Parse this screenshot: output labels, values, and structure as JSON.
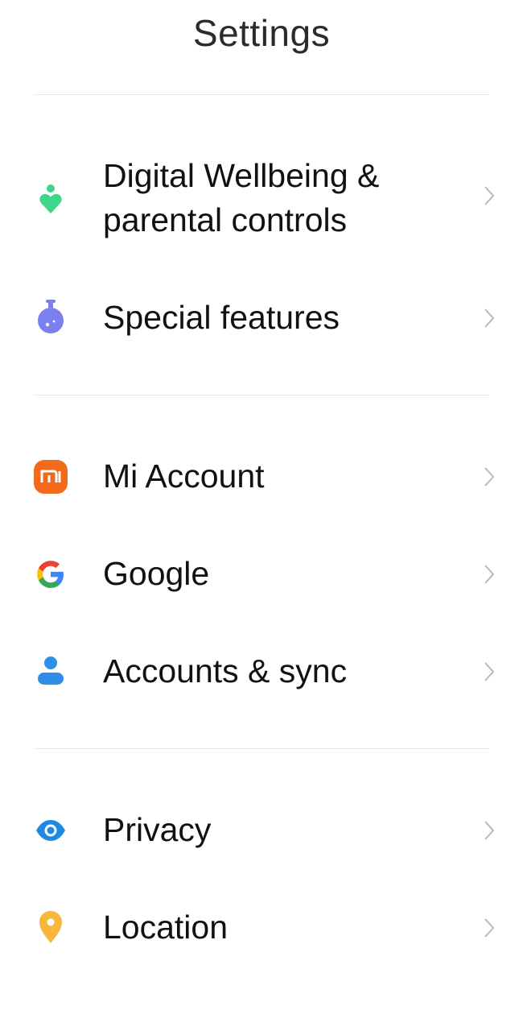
{
  "header": {
    "title": "Settings"
  },
  "sections": [
    {
      "items": [
        {
          "label": "Digital Wellbeing & parental controls",
          "icon": "digital-wellbeing-icon",
          "color": "#3dd68c"
        },
        {
          "label": "Special features",
          "icon": "special-features-icon",
          "color": "#7b7ff0"
        }
      ]
    },
    {
      "items": [
        {
          "label": "Mi Account",
          "icon": "mi-account-icon",
          "color": "#f26a1b"
        },
        {
          "label": "Google",
          "icon": "google-icon",
          "color": "#4285f4"
        },
        {
          "label": "Accounts & sync",
          "icon": "accounts-sync-icon",
          "color": "#2f8fe8"
        }
      ]
    },
    {
      "items": [
        {
          "label": "Privacy",
          "icon": "privacy-icon",
          "color": "#1e88e5"
        },
        {
          "label": "Location",
          "icon": "location-icon",
          "color": "#f6b73c"
        }
      ]
    }
  ],
  "mi_badge": "mi"
}
